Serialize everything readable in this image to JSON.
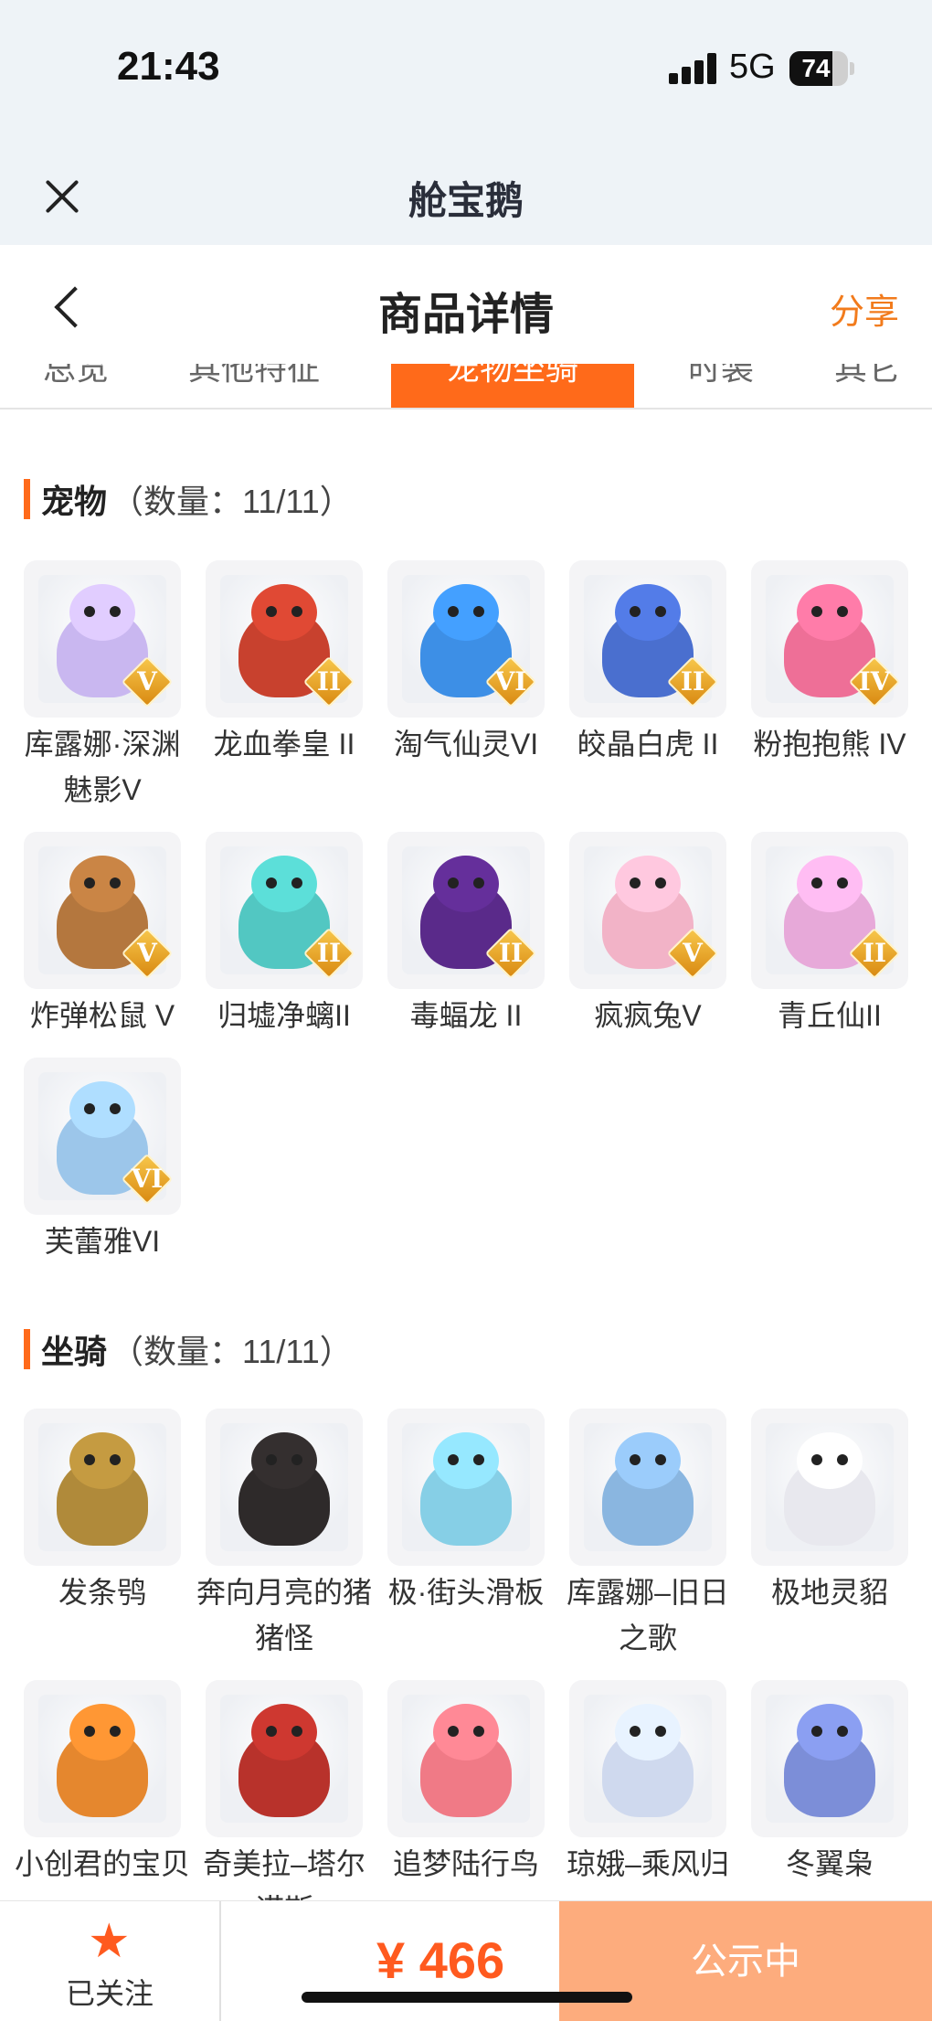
{
  "status_bar": {
    "time": "21:43",
    "network": "5G",
    "battery": "74",
    "battery_level": 0.74
  },
  "app_bar": {
    "title": "舱宝鹅"
  },
  "header": {
    "title": "商品详情",
    "share": "分享"
  },
  "tabs": [
    "总览",
    "其他特征",
    "宠物坐骑",
    "时装",
    "其它"
  ],
  "pets": {
    "title": "宠物",
    "count": "（数量：11/11）",
    "items": [
      {
        "name": "库露娜·深渊魅影V",
        "tier": "V",
        "color": "#c9b7f0"
      },
      {
        "name": "龙血拳皇 II",
        "tier": "II",
        "color": "#c8412e"
      },
      {
        "name": "淘气仙灵VI",
        "tier": "VI",
        "color": "#3d8fe6"
      },
      {
        "name": "皎晶白虎 II",
        "tier": "II",
        "color": "#4a6fcf"
      },
      {
        "name": "粉抱抱熊 IV",
        "tier": "IV",
        "color": "#ee6f97"
      },
      {
        "name": "炸弹松鼠 V",
        "tier": "V",
        "color": "#b4773e"
      },
      {
        "name": "归墟净螭II",
        "tier": "II",
        "color": "#52c7c2"
      },
      {
        "name": "毒蝠龙 II",
        "tier": "II",
        "color": "#5a2a8a"
      },
      {
        "name": "疯疯兔V",
        "tier": "V",
        "color": "#f2b3c7"
      },
      {
        "name": "青丘仙II",
        "tier": "II",
        "color": "#e7a9d9"
      },
      {
        "name": "芙蕾雅VI",
        "tier": "VI",
        "color": "#9cc6ea"
      }
    ]
  },
  "mounts": {
    "title": "坐骑",
    "count": "（数量：11/11）",
    "items": [
      {
        "name": "发条鸮",
        "color": "#b08a3a"
      },
      {
        "name": "奔向月亮的猪猪怪",
        "color": "#2e2a2a"
      },
      {
        "name": "极·街头滑板",
        "color": "#86cfe6"
      },
      {
        "name": "库露娜–旧日之歌",
        "color": "#8ab6e0"
      },
      {
        "name": "极地灵貂",
        "color": "#e8e8ee"
      },
      {
        "name": "小创君的宝贝",
        "color": "#e5872e"
      },
      {
        "name": "奇美拉–塔尔诺斯",
        "color": "#b8322b"
      },
      {
        "name": "追梦陆行鸟",
        "color": "#f07a86"
      },
      {
        "name": "琼娥–乘风归",
        "color": "#cfd9ee"
      },
      {
        "name": "冬翼枭",
        "color": "#7c8ed8"
      }
    ]
  },
  "bottom": {
    "follow_label": "已关注",
    "price": "¥ 466",
    "status": "公示中"
  }
}
